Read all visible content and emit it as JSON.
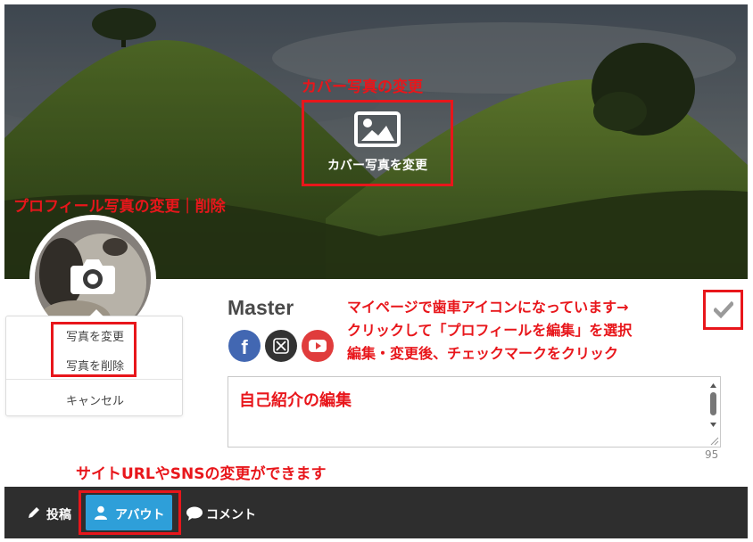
{
  "annotations": {
    "cover_title": "カバー写真の変更",
    "profile_title": "プロフィール写真の変更｜削除",
    "note_line1": "マイページで歯車アイコンになっています→",
    "note_line2": "クリックして「プロフィールを編集」を選択",
    "note_line3": "編集・変更後、チェックマークをクリック",
    "bio_hint": "自己紹介の編集",
    "site_hint": "サイトURLやSNSの変更ができます"
  },
  "cover": {
    "change_label": "カバー写真を変更",
    "icon": "image-icon"
  },
  "avatar": {
    "icon": "camera-icon"
  },
  "avatar_menu": {
    "change": "写真を変更",
    "delete": "写真を削除",
    "cancel": "キャンセル"
  },
  "profile": {
    "username": "Master"
  },
  "social": [
    {
      "icon": "facebook-icon",
      "glyph": "f",
      "color": "#4267b2"
    },
    {
      "icon": "x-icon",
      "glyph": "𝕏",
      "color": "#333333"
    },
    {
      "icon": "youtube-icon",
      "glyph": "▶",
      "color": "#e03c3c"
    }
  ],
  "bio": {
    "char_count": "95"
  },
  "tabs": {
    "posts": "投稿",
    "about": "アバウト",
    "comments": "コメント"
  },
  "colors": {
    "annotation_red": "#e8161b",
    "tab_active": "#2e9fd9",
    "bottom_bar": "#2e2e2e"
  }
}
